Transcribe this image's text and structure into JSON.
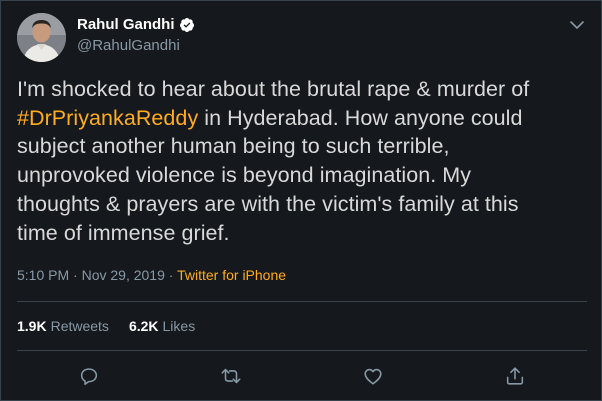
{
  "author": {
    "name": "Rahul Gandhi",
    "handle": "@RahulGandhi",
    "verified": true,
    "verified_icon": "verified-badge-icon"
  },
  "tweet": {
    "line1": "I'm shocked to hear about the brutal rape & murder of",
    "hashtag": "#DrPriyankaReddy",
    "line2_rest": " in Hyderabad. How anyone could",
    "line3": "subject another human being to such terrible,",
    "line4": "unprovoked violence is beyond imagination. My",
    "line5": "thoughts & prayers are with the victim's family at this",
    "line6": "time of immense grief."
  },
  "meta": {
    "time": "5:10 PM",
    "separator1": " · ",
    "date": "Nov 29, 2019",
    "separator2": " · ",
    "source": "Twitter for iPhone"
  },
  "stats": {
    "retweets_count": "1.9K",
    "retweets_label": "Retweets",
    "likes_count": "6.2K",
    "likes_label": "Likes"
  },
  "actions": [
    "reply-icon",
    "retweet-icon",
    "like-icon",
    "share-icon"
  ],
  "colors": {
    "background": "#15181c",
    "accent": "#ffad1f",
    "muted": "#8899a6",
    "border": "#38444d",
    "text": "#d9d9d9"
  }
}
